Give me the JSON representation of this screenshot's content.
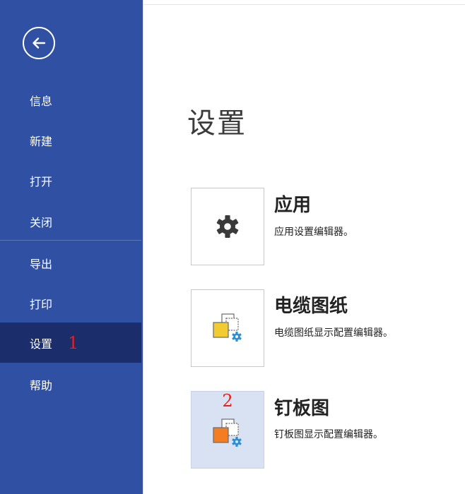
{
  "sidebar": {
    "back_icon": "back-arrow-circle-icon",
    "items": [
      {
        "label": "信息"
      },
      {
        "label": "新建"
      },
      {
        "label": "打开"
      },
      {
        "label": "关闭"
      },
      {
        "label": "导出"
      },
      {
        "label": "打印"
      },
      {
        "label": "设置",
        "selected": true,
        "marker": "1"
      },
      {
        "label": "帮助"
      }
    ],
    "bg_color": "#2f50a3",
    "selected_color": "#1b2e6b"
  },
  "main": {
    "title": "设置",
    "options": [
      {
        "title": "应用",
        "description": "应用设置编辑器。",
        "icon": "gear-icon"
      },
      {
        "title": "电缆图纸",
        "description": "电缆图纸显示配置编辑器。",
        "icon": "cable-drawing-config-icon",
        "accent": "#f2cc2e"
      },
      {
        "title": "钉板图",
        "description": "钉板图显示配置编辑器。",
        "icon": "nailboard-config-icon",
        "accent": "#f57c20",
        "highlighted": true,
        "marker": "2"
      }
    ]
  }
}
